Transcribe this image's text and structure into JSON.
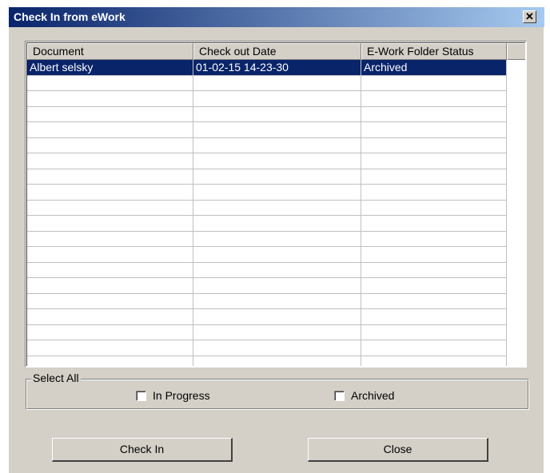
{
  "window": {
    "title": "Check In from eWork",
    "close_glyph": "✕"
  },
  "list": {
    "columns": [
      "Document",
      "Check out Date",
      "E-Work Folder Status"
    ],
    "rows": [
      {
        "document": "Albert selsky",
        "date": "01-02-15 14-23-30",
        "status": "Archived",
        "selected": true
      }
    ]
  },
  "select_all": {
    "label": "Select All",
    "in_progress_label": "In Progress",
    "archived_label": "Archived"
  },
  "buttons": {
    "check_in": "Check In",
    "close": "Close"
  },
  "colors": {
    "selection": "#0a246a",
    "title_gradient_start": "#0a246a",
    "title_gradient_end": "#a6caf0",
    "face": "#d4d0c8"
  }
}
